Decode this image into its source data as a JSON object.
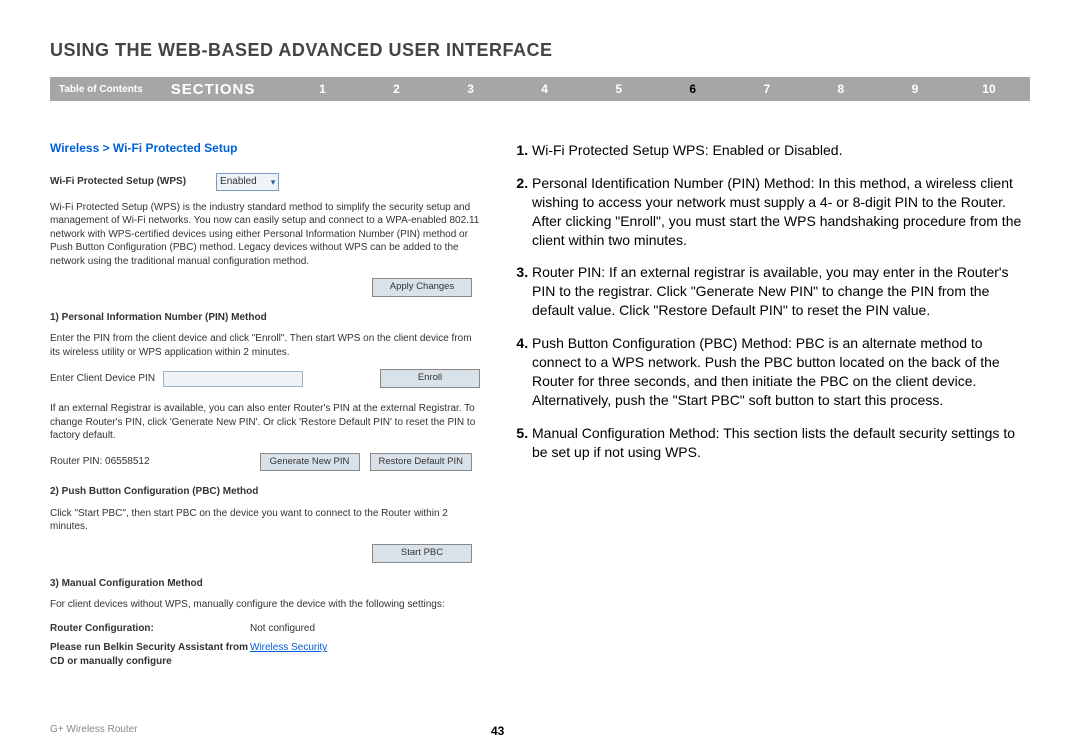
{
  "title": "USING THE WEB-BASED ADVANCED USER INTERFACE",
  "nav": {
    "toc": "Table of Contents",
    "sections_label": "SECTIONS",
    "numbers": [
      "1",
      "2",
      "3",
      "4",
      "5",
      "6",
      "7",
      "8",
      "9",
      "10"
    ],
    "active": "6"
  },
  "breadcrumb": "Wireless > Wi-Fi Protected Setup",
  "panel": {
    "wps_label": "Wi-Fi Protected Setup (WPS)",
    "wps_value": "Enabled",
    "intro": "Wi-Fi Protected Setup (WPS) is the industry standard method to simplify the security setup and management of Wi-Fi networks. You now can easily setup and connect to a WPA-enabled 802.11 network with WPS-certified devices using either Personal Information Number (PIN) method or Push Button Configuration (PBC) method. Legacy devices without WPS can be added to the network using the traditional manual configuration method.",
    "apply_btn": "Apply Changes",
    "sec1_h": "1) Personal Information Number (PIN) Method",
    "sec1_p": "Enter the PIN from the client device and click \"Enroll\". Then start WPS on the client device from its wireless utility or WPS application within 2 minutes.",
    "enter_pin_label": "Enter Client Device PIN",
    "enroll_btn": "Enroll",
    "registrar_p": "If an external Registrar is available, you can also enter Router's PIN at the external Registrar. To change Router's PIN, click 'Generate New PIN'. Or click 'Restore Default PIN' to reset the PIN to factory default.",
    "router_pin_label": "Router PIN:",
    "router_pin_value": "06558512",
    "gen_pin_btn": "Generate New PIN",
    "restore_pin_btn": "Restore Default PIN",
    "sec2_h": "2) Push Button Configuration (PBC) Method",
    "sec2_p": "Click \"Start PBC\", then start PBC on the device you want to connect to the Router within 2 minutes.",
    "start_pbc_btn": "Start PBC",
    "sec3_h": "3) Manual Configuration Method",
    "sec3_p": "For client devices without WPS, manually configure the device with the following settings:",
    "conf_label": "Router Configuration:",
    "conf_value": "Not configured",
    "advice_label": "Please run Belkin Security Assistant from CD or manually configure",
    "advice_link": "Wireless Security"
  },
  "list": {
    "i1": "Wi-Fi Protected Setup WPS: Enabled or Disabled.",
    "i2": "Personal Identification Number (PIN) Method: In this method, a wireless client wishing to access your network must supply a 4- or 8-digit PIN to the Router. After clicking \"Enroll\", you must start the WPS handshaking procedure from the client within two minutes.",
    "i3": "Router PIN: If an external registrar is available, you may enter in the Router's PIN to the registrar. Click \"Generate New PIN\" to change the PIN from the default value. Click \"Restore Default PIN\" to reset the PIN value.",
    "i4": "Push Button Configuration (PBC) Method: PBC is an alternate method to connect to a WPS network. Push the PBC button located on the back of the Router for three seconds, and then initiate the PBC on the client device. Alternatively, push the \"Start PBC\" soft button to start this process.",
    "i5": "Manual Configuration Method: This section lists the default security settings to be set up if not using WPS."
  },
  "footer": {
    "product": "G+ Wireless Router",
    "page": "43"
  }
}
